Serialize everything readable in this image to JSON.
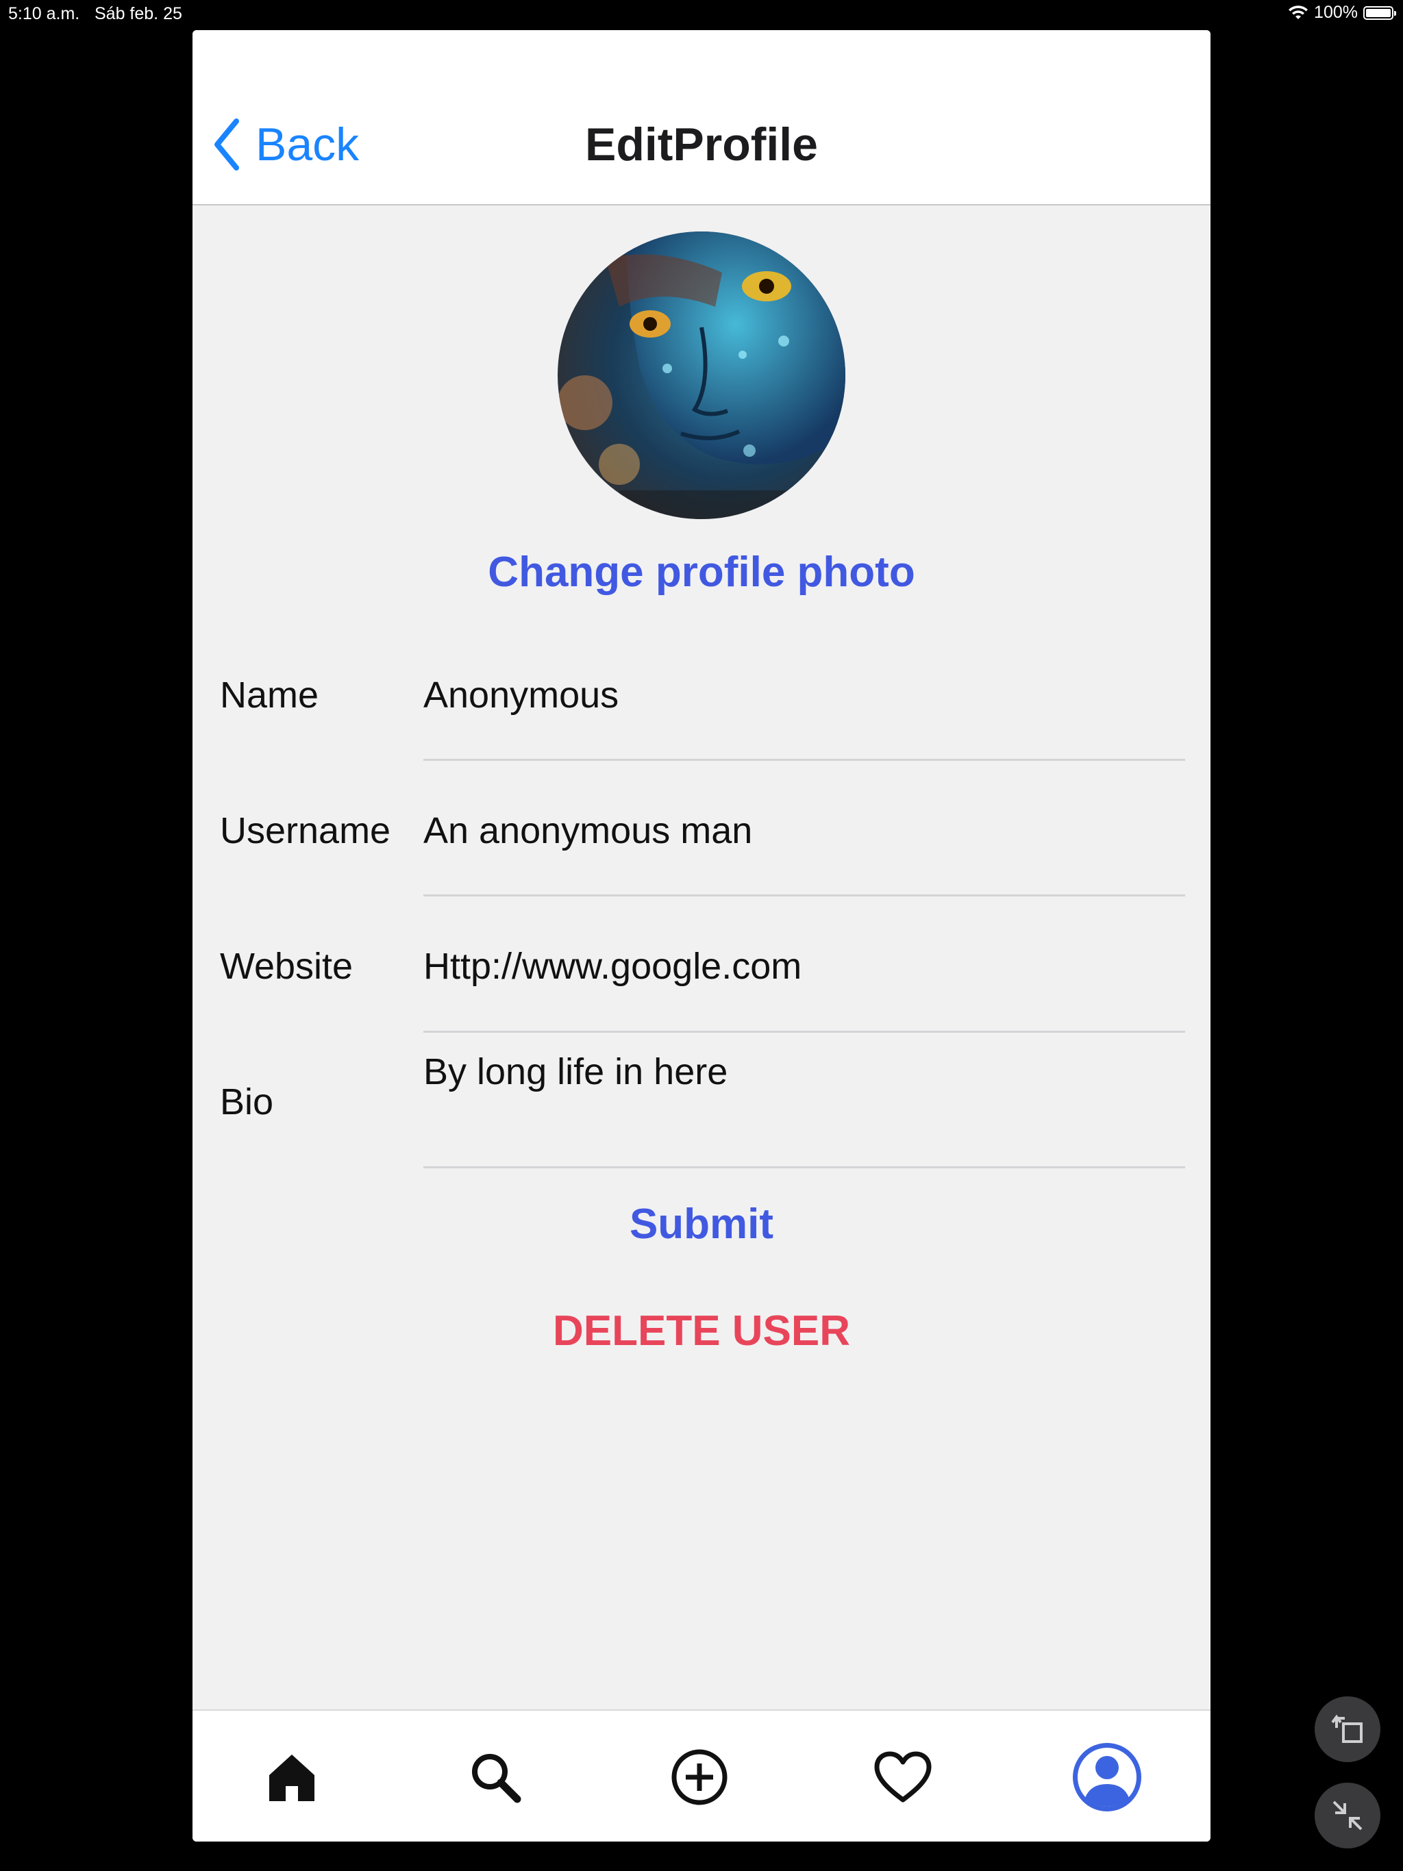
{
  "status_bar": {
    "time": "5:10 a.m.",
    "date": "Sáb feb. 25",
    "battery": "100%"
  },
  "header": {
    "back_label": "Back",
    "title": "EditProfile"
  },
  "profile": {
    "change_photo_label": "Change profile photo"
  },
  "form": {
    "fields": [
      {
        "label": "Name",
        "value": "Anonymous"
      },
      {
        "label": "Username",
        "value": "An anonymous man"
      },
      {
        "label": "Website",
        "value": "Http://www.google.com"
      },
      {
        "label": "Bio",
        "value": "By long life in here"
      }
    ],
    "submit_label": "Submit",
    "delete_label": "DELETE USER"
  },
  "tab_bar": {
    "items": [
      {
        "icon": "home-icon"
      },
      {
        "icon": "search-icon"
      },
      {
        "icon": "add-circle-icon"
      },
      {
        "icon": "heart-icon"
      },
      {
        "icon": "profile-icon",
        "active": true
      }
    ]
  },
  "colors": {
    "accent": "#4159e1",
    "link": "#1a84ff",
    "danger": "#e8455a",
    "background": "#f1f1f2"
  }
}
